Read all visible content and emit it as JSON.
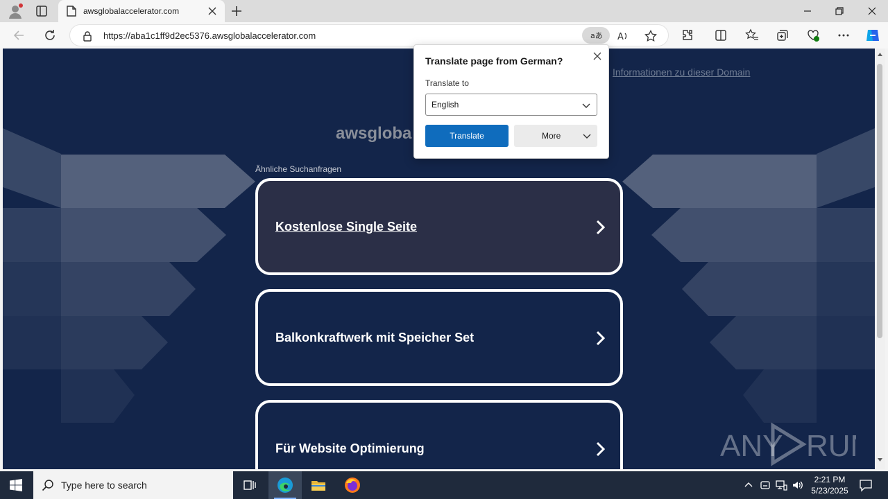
{
  "browser": {
    "tab_title": "awsglobalaccelerator.com",
    "url": "https://aba1c1ff9d2ec5376.awsglobalaccelerator.com"
  },
  "page": {
    "domain_info_link": "Informationen zu dieser Domain",
    "site_name_visible": "awsgloba",
    "section_label": "Ähnliche Suchanfragen",
    "cards": [
      {
        "label": "Kostenlose Single Seite",
        "bg": "#2b2f47",
        "underlined": true
      },
      {
        "label": "Balkonkraftwerk mit Speicher Set",
        "bg": "#13254a",
        "underlined": false
      },
      {
        "label": "Für Website Optimierung",
        "bg": "#13254a",
        "underlined": false
      }
    ],
    "watermark": {
      "left": "ANY",
      "right": "RUN"
    }
  },
  "translate_popup": {
    "title": "Translate page from German?",
    "translate_to_label": "Translate to",
    "selected_language": "English",
    "translate_button": "Translate",
    "more_button": "More"
  },
  "taskbar": {
    "search_placeholder": "Type here to search",
    "time": "2:21 PM",
    "date": "5/23/2025"
  },
  "colors": {
    "page_bg": "#13254a",
    "primary_button": "#0f6cbd"
  }
}
